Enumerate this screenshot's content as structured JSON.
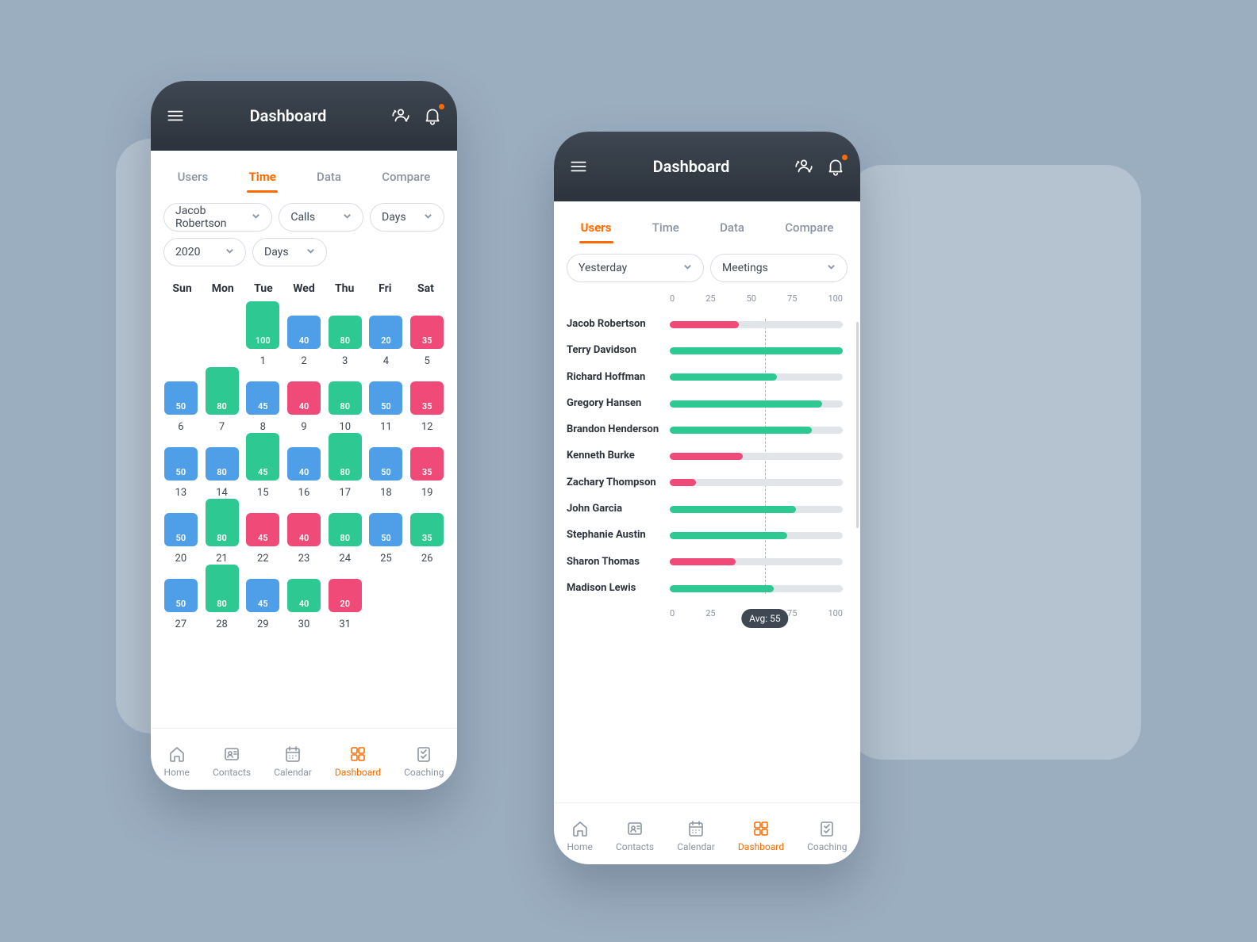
{
  "header": {
    "title": "Dashboard"
  },
  "tabs": {
    "users": "Users",
    "time": "Time",
    "data": "Data",
    "compare": "Compare"
  },
  "left": {
    "activeTab": "time",
    "filters": {
      "user": "Jacob Robertson",
      "metric": "Calls",
      "unit1": "Days",
      "year": "2020",
      "unit2": "Days"
    },
    "dow": [
      "Sun",
      "Mon",
      "Tue",
      "Wed",
      "Thu",
      "Fri",
      "Sat"
    ],
    "weeks": [
      [
        null,
        null,
        {
          "d": 1,
          "v": 100,
          "c": "g",
          "h": true
        },
        {
          "d": 2,
          "v": 40,
          "c": "b"
        },
        {
          "d": 3,
          "v": 80,
          "c": "g"
        },
        {
          "d": 4,
          "v": 20,
          "c": "b"
        },
        {
          "d": 5,
          "v": 35,
          "c": "r"
        }
      ],
      [
        {
          "d": 6,
          "v": 50,
          "c": "b"
        },
        {
          "d": 7,
          "v": 80,
          "c": "g",
          "h": true
        },
        {
          "d": 8,
          "v": 45,
          "c": "b"
        },
        {
          "d": 9,
          "v": 40,
          "c": "r"
        },
        {
          "d": 10,
          "v": 80,
          "c": "g"
        },
        {
          "d": 11,
          "v": 50,
          "c": "b"
        },
        {
          "d": 12,
          "v": 35,
          "c": "r"
        }
      ],
      [
        {
          "d": 13,
          "v": 50,
          "c": "b"
        },
        {
          "d": 14,
          "v": 80,
          "c": "b"
        },
        {
          "d": 15,
          "v": 45,
          "c": "g",
          "h": true
        },
        {
          "d": 16,
          "v": 40,
          "c": "b"
        },
        {
          "d": 17,
          "v": 80,
          "c": "g",
          "h": true
        },
        {
          "d": 18,
          "v": 50,
          "c": "b"
        },
        {
          "d": 19,
          "v": 35,
          "c": "r"
        }
      ],
      [
        {
          "d": 20,
          "v": 50,
          "c": "b"
        },
        {
          "d": 21,
          "v": 80,
          "c": "g",
          "h": true
        },
        {
          "d": 22,
          "v": 45,
          "c": "r"
        },
        {
          "d": 23,
          "v": 40,
          "c": "r"
        },
        {
          "d": 24,
          "v": 80,
          "c": "g"
        },
        {
          "d": 25,
          "v": 50,
          "c": "b"
        },
        {
          "d": 26,
          "v": 35,
          "c": "g"
        }
      ],
      [
        {
          "d": 27,
          "v": 50,
          "c": "b"
        },
        {
          "d": 28,
          "v": 80,
          "c": "g",
          "h": true
        },
        {
          "d": 29,
          "v": 45,
          "c": "b"
        },
        {
          "d": 30,
          "v": 40,
          "c": "g"
        },
        {
          "d": 31,
          "v": 20,
          "c": "r"
        },
        null,
        null
      ]
    ]
  },
  "right": {
    "activeTab": "users",
    "filters": {
      "range": "Yesterday",
      "metric": "Meetings"
    },
    "avg": {
      "label": "Avg:",
      "value": 55
    }
  },
  "chart_data": {
    "type": "bar",
    "orientation": "horizontal",
    "xlim": [
      0,
      100
    ],
    "ticks": [
      0,
      25,
      50,
      75,
      100
    ],
    "avg": 55,
    "series": [
      {
        "name": "Jacob Robertson",
        "value": 40,
        "color": "red"
      },
      {
        "name": "Terry Davidson",
        "value": 100,
        "color": "green"
      },
      {
        "name": "Richard Hoffman",
        "value": 62,
        "color": "green"
      },
      {
        "name": "Gregory Hansen",
        "value": 88,
        "color": "green"
      },
      {
        "name": "Brandon Henderson",
        "value": 82,
        "color": "green"
      },
      {
        "name": "Kenneth Burke",
        "value": 42,
        "color": "red"
      },
      {
        "name": "Zachary Thompson",
        "value": 15,
        "color": "red"
      },
      {
        "name": "John Garcia",
        "value": 73,
        "color": "green"
      },
      {
        "name": "Stephanie Austin",
        "value": 68,
        "color": "green"
      },
      {
        "name": "Sharon Thomas",
        "value": 38,
        "color": "red"
      },
      {
        "name": "Madison Lewis",
        "value": 60,
        "color": "green"
      }
    ]
  },
  "nav": {
    "home": "Home",
    "contacts": "Contacts",
    "calendar": "Calendar",
    "dashboard": "Dashboard",
    "coaching": "Coaching"
  }
}
